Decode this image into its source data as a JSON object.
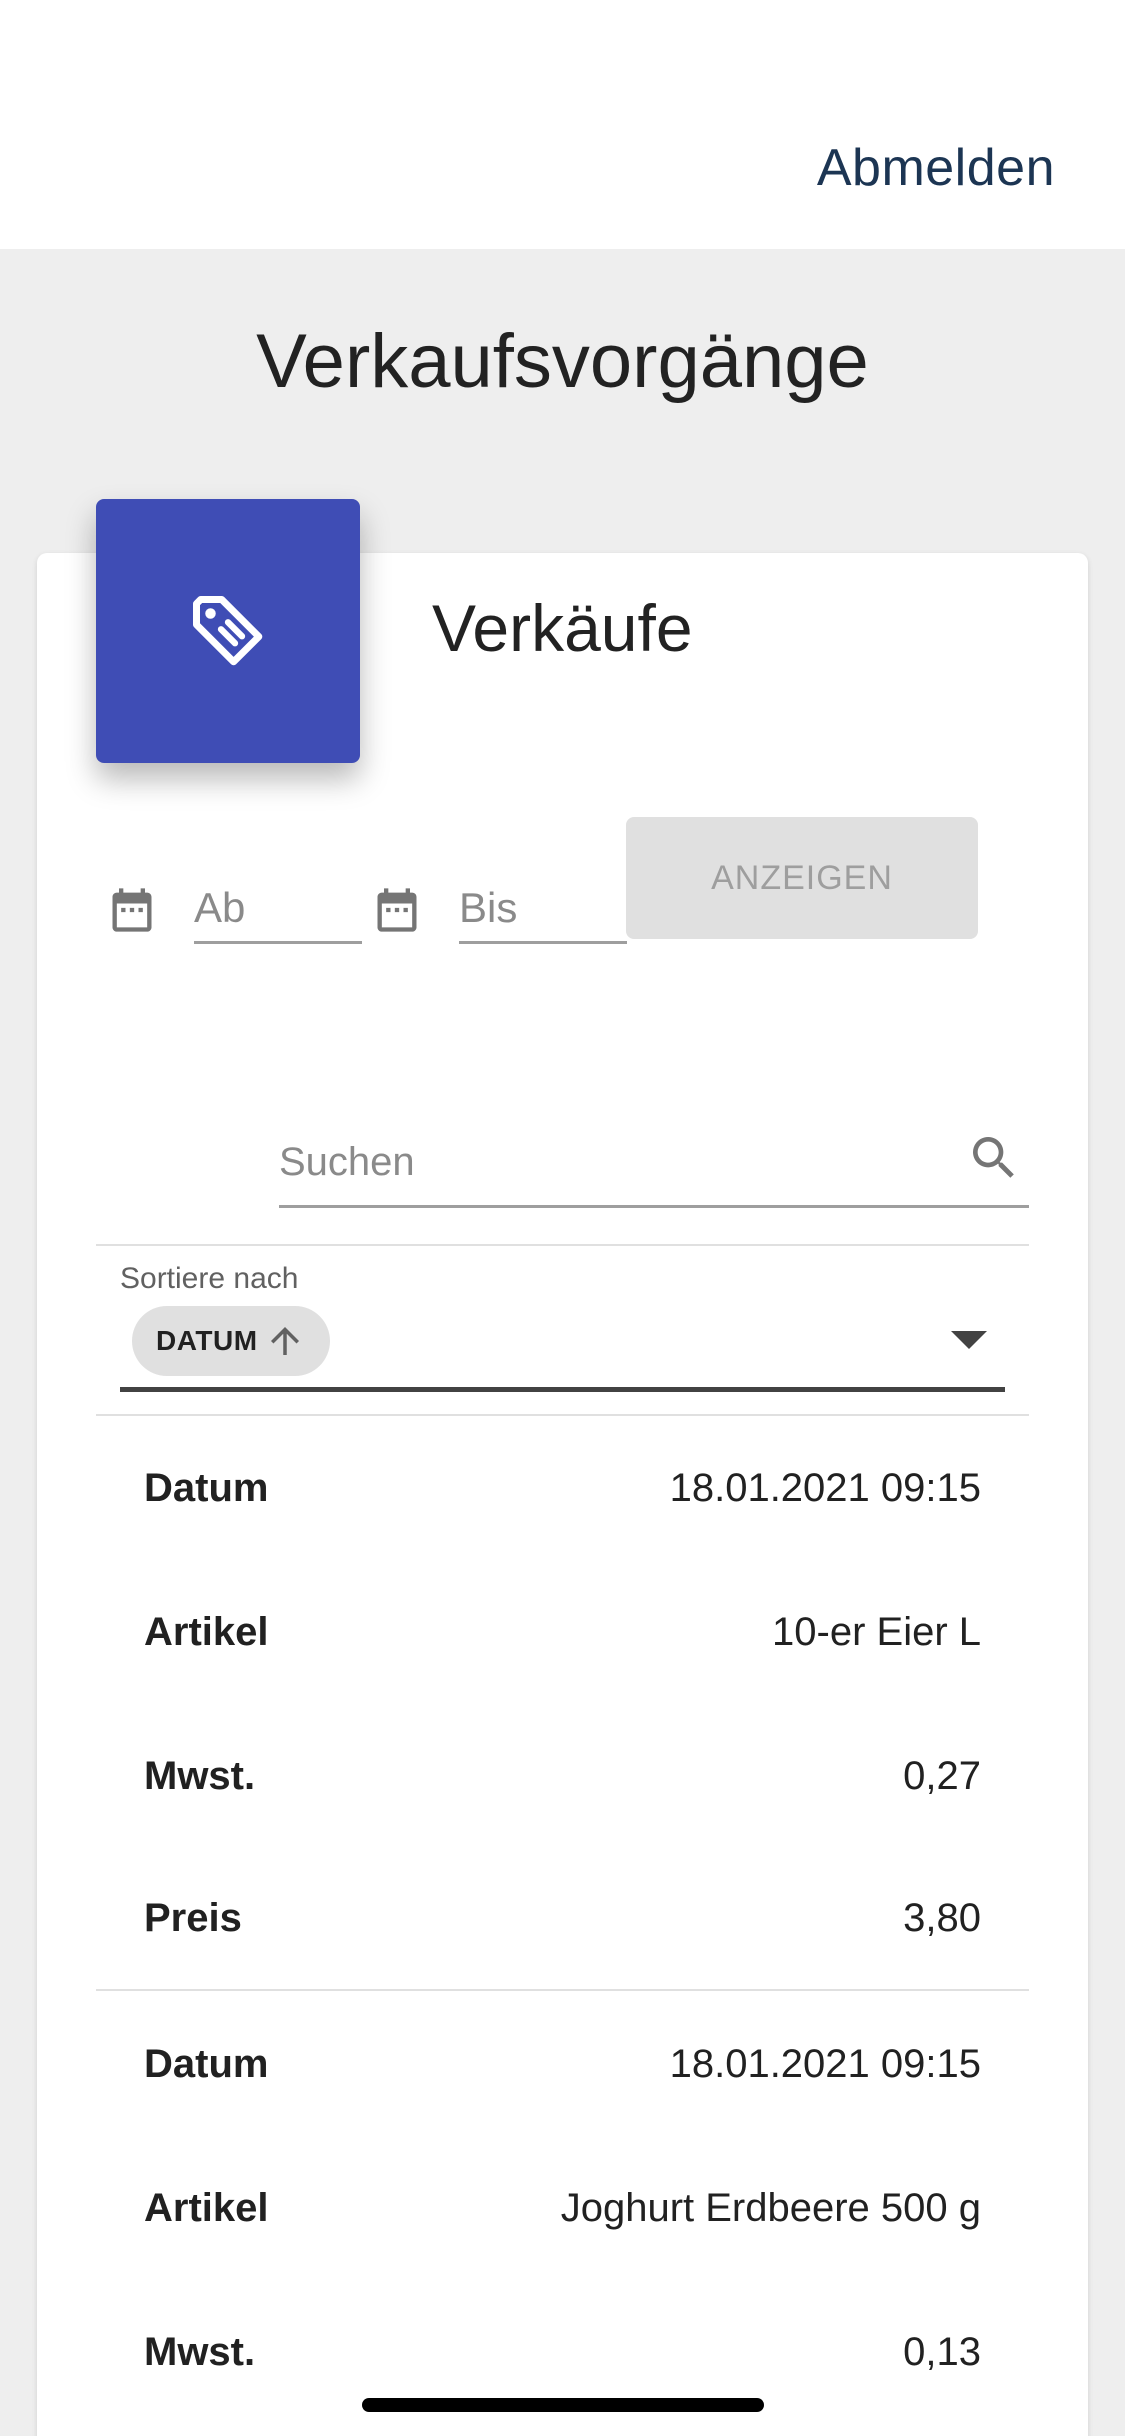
{
  "header": {
    "logout_label": "Abmelden"
  },
  "page": {
    "title": "Verkaufsvorgänge"
  },
  "card": {
    "title": "Verkäufe",
    "icon": "tag-icon",
    "filter": {
      "from_placeholder": "Ab",
      "to_placeholder": "Bis",
      "show_button": "ANZEIGEN"
    },
    "search": {
      "placeholder": "Suchen"
    },
    "sort": {
      "label": "Sortiere nach",
      "chip": "DATUM",
      "chip_icon": "arrow-up-icon"
    },
    "records": [
      {
        "date_label": "Datum",
        "date": "18.01.2021 09:15",
        "item_label": "Artikel",
        "item": "10-er Eier L",
        "vat_label": "Mwst.",
        "vat": "0,27",
        "price_label": "Preis",
        "price": "3,80"
      },
      {
        "date_label": "Datum",
        "date": "18.01.2021 09:15",
        "item_label": "Artikel",
        "item": "Joghurt Erdbeere 500 g",
        "vat_label": "Mwst.",
        "vat": "0,13"
      }
    ]
  },
  "colors": {
    "accent": "#3f4db5",
    "logout": "#1c3553",
    "background": "#eeeeee"
  }
}
